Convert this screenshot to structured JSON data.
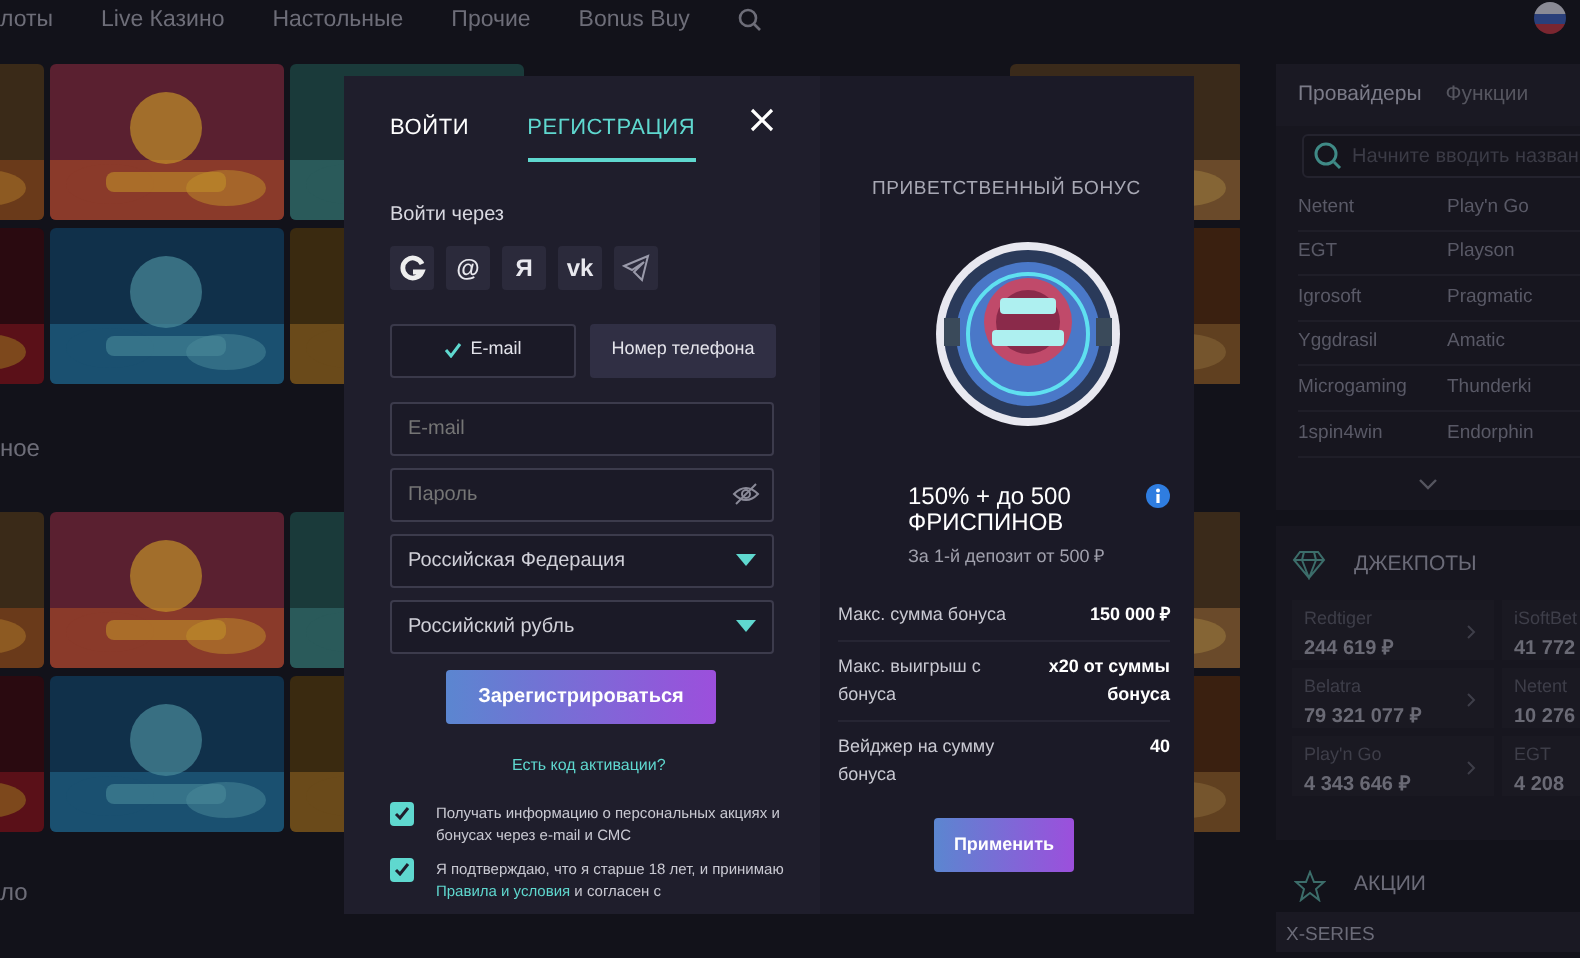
{
  "top_nav": {
    "items": [
      "лоты",
      "Live Казино",
      "Настольные",
      "Прочие",
      "Bonus Buy"
    ]
  },
  "sections": [
    {
      "heading": "ное"
    },
    {
      "heading": "ло"
    }
  ],
  "sidebar": {
    "tabs": [
      {
        "label": "Провайдеры",
        "selected": true
      },
      {
        "label": "Функции",
        "selected": false
      }
    ],
    "search": {
      "placeholder": "Начните вводить назван"
    },
    "providers": [
      [
        "Netent",
        "Play'n Go"
      ],
      [
        "EGT",
        "Playson"
      ],
      [
        "Igrosoft",
        "Pragmatic"
      ],
      [
        "Yggdrasil",
        "Amatic"
      ],
      [
        "Microgaming",
        "Thunderki"
      ],
      [
        "1spin4win",
        "Endorphin"
      ]
    ],
    "jackpots": {
      "title": "ДЖЕКПОТЫ",
      "items": [
        {
          "name": "Redtiger",
          "amount": "244 619 ₽"
        },
        {
          "name": "iSoftBet",
          "amount": "41 772"
        },
        {
          "name": "Belatra",
          "amount": "79 321 077 ₽"
        },
        {
          "name": "Netent",
          "amount": "10 276"
        },
        {
          "name": "Play'n Go",
          "amount": "4 343 646 ₽"
        },
        {
          "name": "EGT",
          "amount": "4 208"
        }
      ]
    },
    "promotions": {
      "title": "АКЦИИ",
      "first": "X-SERIES"
    }
  },
  "modal": {
    "tabs": [
      {
        "label": "ВОЙТИ",
        "selected": false
      },
      {
        "label": "РЕГИСТРАЦИЯ",
        "selected": true
      }
    ],
    "social_label": "Войти через",
    "social": [
      {
        "kind": "icon"
      },
      {
        "kind": "glyph",
        "label": "@"
      },
      {
        "kind": "glyph",
        "label": "Я"
      },
      {
        "kind": "glyph",
        "label": "vk"
      },
      {
        "kind": "telegram"
      }
    ],
    "methods": [
      {
        "label": "E-mail",
        "selected": true
      },
      {
        "label": "Номер телефона",
        "selected": false
      }
    ],
    "fields": [
      {
        "kind": "input",
        "placeholder": "E-mail"
      },
      {
        "kind": "password",
        "placeholder": "Пароль"
      },
      {
        "kind": "select",
        "value": "Российская Федерация"
      },
      {
        "kind": "select",
        "value": "Российский рубль"
      }
    ],
    "submit": "Зарегистрироваться",
    "activation_link": "Есть код активации?",
    "consents": [
      {
        "checked": true,
        "text": "Получать информацию о персональных акциях и бонусах через e-mail и СМС"
      },
      {
        "checked": true,
        "text": "Я подтверждаю, что я старше 18 лет, и принимаю ",
        "link": "Правила и условия",
        "after": " и согласен с"
      }
    ],
    "bonus": {
      "heading": "ПРИВЕТСТВЕННЫЙ БОНУС",
      "title": "150% + до 500 ФРИСПИНОВ",
      "subtitle": "За 1-й депозит от 500 ₽",
      "rows": [
        {
          "label": "Макс. сумма бонуса",
          "value": "150 000 ₽"
        },
        {
          "label": "Макс. выигрыш с бонуса",
          "value": "x20 от суммы бонуса"
        },
        {
          "label": "Вейджер на сумму бонуса",
          "value": "40"
        }
      ],
      "apply": "Применить"
    }
  }
}
